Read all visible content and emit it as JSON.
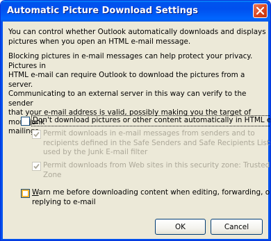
{
  "window": {
    "title": "Automatic Picture Download Settings"
  },
  "paragraphs": {
    "p1_lines": [
      "You can control whether Outlook automatically downloads and displays",
      "pictures when you open an HTML e-mail message."
    ],
    "p2_lines": [
      "Blocking pictures in e-mail messages can help protect your privacy. Pictures in",
      "HTML e-mail can require Outlook to download the pictures from a server.",
      "Communicating to an external server in this way can verify to the sender",
      "that your e-mail address is valid, possibly making you the target of more junk",
      "mailings."
    ]
  },
  "options": {
    "dont_download": {
      "label_underlined": "D",
      "label_rest": "on't download pictures or other content automatically in HTML e-mail",
      "checked": false
    },
    "safe_senders": {
      "lines": [
        "Permit downloads in e-mail messages from senders and to",
        "recipients defined in the Safe Senders and Safe Recipients Lists",
        "used by the Junk E-mail filter"
      ],
      "checked": true,
      "disabled": true
    },
    "trusted_zone": {
      "lines": [
        "Permit downloads from Web sites in this security zone: Trusted",
        "Zone"
      ],
      "checked": true,
      "disabled": true
    },
    "warn_me": {
      "label_underlined": "W",
      "label_line1_rest": "arn me before downloading content when editing, forwarding, or",
      "label_line2": "replying to e-mail",
      "checked": false
    }
  },
  "buttons": {
    "ok": "OK",
    "cancel": "Cancel"
  },
  "colors": {
    "title_bar": "#0050ee",
    "dialog_bg": "#ece9d8",
    "disabled_text": "#aca899"
  }
}
